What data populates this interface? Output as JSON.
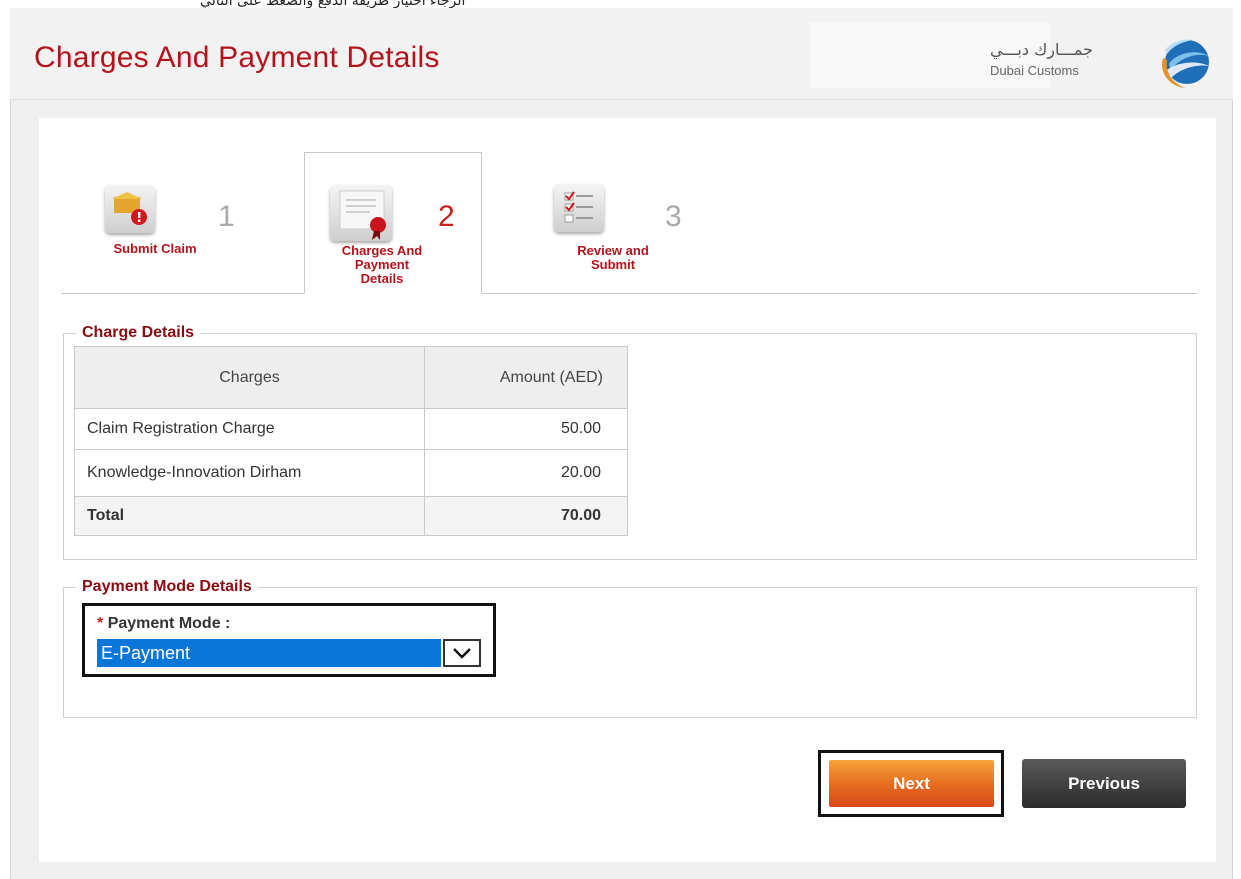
{
  "top_strip": {
    "text": "ﺍﻟﺮﺟﺎﺀ ﺍﺧﺘﻴﺎﺭ ﻃﺮﻳﻘﺔ ﺍﻟﺪﻓﻊ ﻭﺍﻟﻀﻐﻂ ﻋﻠﻰ ﺍﻟﺘﺎﻟﻲ"
  },
  "header": {
    "title": "Charges And Payment Details",
    "logo": {
      "arabic_text": "جمـــارك دبـــي",
      "english_text": "Dubai Customs"
    }
  },
  "steps": [
    {
      "number": "1",
      "label": "Submit Claim",
      "icon": "folder-alert-icon",
      "active": false
    },
    {
      "number": "2",
      "label": "Charges And Payment Details",
      "icon": "certificate-icon",
      "active": true
    },
    {
      "number": "3",
      "label": "Review and Submit",
      "icon": "checklist-icon",
      "active": false
    }
  ],
  "charge_details": {
    "legend": "Charge Details",
    "columns": [
      "Charges",
      "Amount (AED)"
    ],
    "rows": [
      {
        "charge": "Claim Registration Charge",
        "amount": "50.00"
      },
      {
        "charge": "Knowledge-Innovation Dirham",
        "amount": "20.00"
      }
    ],
    "total": {
      "label": "Total",
      "amount": "70.00"
    }
  },
  "payment_mode": {
    "legend": "Payment Mode Details",
    "required_marker": "*",
    "label": "Payment Mode :",
    "selected": "E-Payment"
  },
  "buttons": {
    "next": "Next",
    "previous": "Previous"
  },
  "colors": {
    "title_red": "#b3141c",
    "legend_red": "#8b0c10",
    "next_orange": "#e46920",
    "previous_dark": "#2c2c2c",
    "select_blue": "#0a76d8"
  }
}
